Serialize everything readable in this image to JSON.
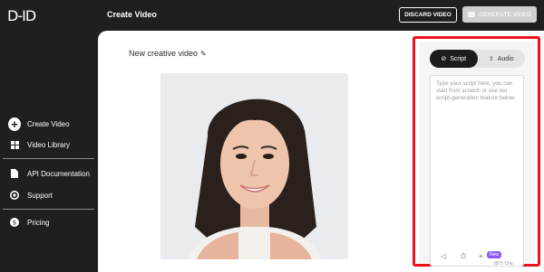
{
  "app": {
    "logo_text": "D-ID",
    "page_title": "Create Video"
  },
  "header": {
    "discard_label": "DISCARD VIDEO",
    "generate_label": "GENERATE VIDEO"
  },
  "sidebar": {
    "items": [
      {
        "label": "Create Video",
        "icon": "plus-circle-icon"
      },
      {
        "label": "Video Library",
        "icon": "grid-icon"
      },
      {
        "label": "API Documentation",
        "icon": "document-icon"
      },
      {
        "label": "Support",
        "icon": "support-icon"
      },
      {
        "label": "Pricing",
        "icon": "dollar-icon"
      }
    ]
  },
  "editor": {
    "video_title": "New creative video"
  },
  "panel": {
    "tabs": [
      {
        "label": "Script",
        "icon": "script-icon",
        "active": true
      },
      {
        "label": "Audio",
        "icon": "upload-icon",
        "active": false
      }
    ],
    "script_placeholder": "Type your script here, you can start from scratch or use our script-generation feature below.",
    "new_badge": "New",
    "char_count": "3875 Cha"
  },
  "colors": {
    "background": "#1f1f1f",
    "highlight_border": "#e8121c",
    "badge": "#8b5cf6"
  }
}
